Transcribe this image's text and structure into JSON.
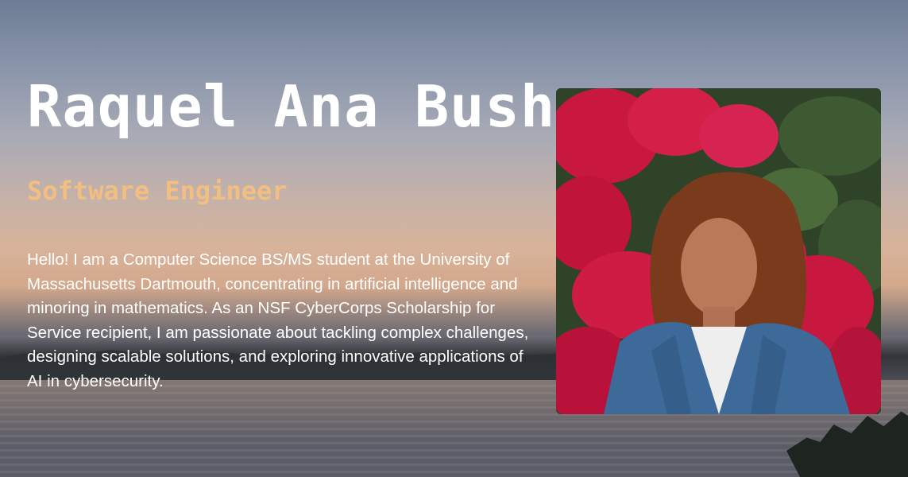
{
  "hero": {
    "name": "Raquel Ana Bush",
    "role": "Software Engineer",
    "bio": "Hello! I am a Computer Science BS/MS student at the University of Massachusetts Dartmouth, concentrating in artificial intelligence and minoring in mathematics. As an NSF CyberCorps Scholarship for Service recipient, I am passionate about tackling complex challenges, designing scalable solutions, and exploring innovative applications of AI in cybersecurity."
  },
  "colors": {
    "name": "#ffffff",
    "role_accent": "#f2be82",
    "bio": "#ffffff"
  },
  "icons": {
    "portrait": "portrait-photo"
  }
}
